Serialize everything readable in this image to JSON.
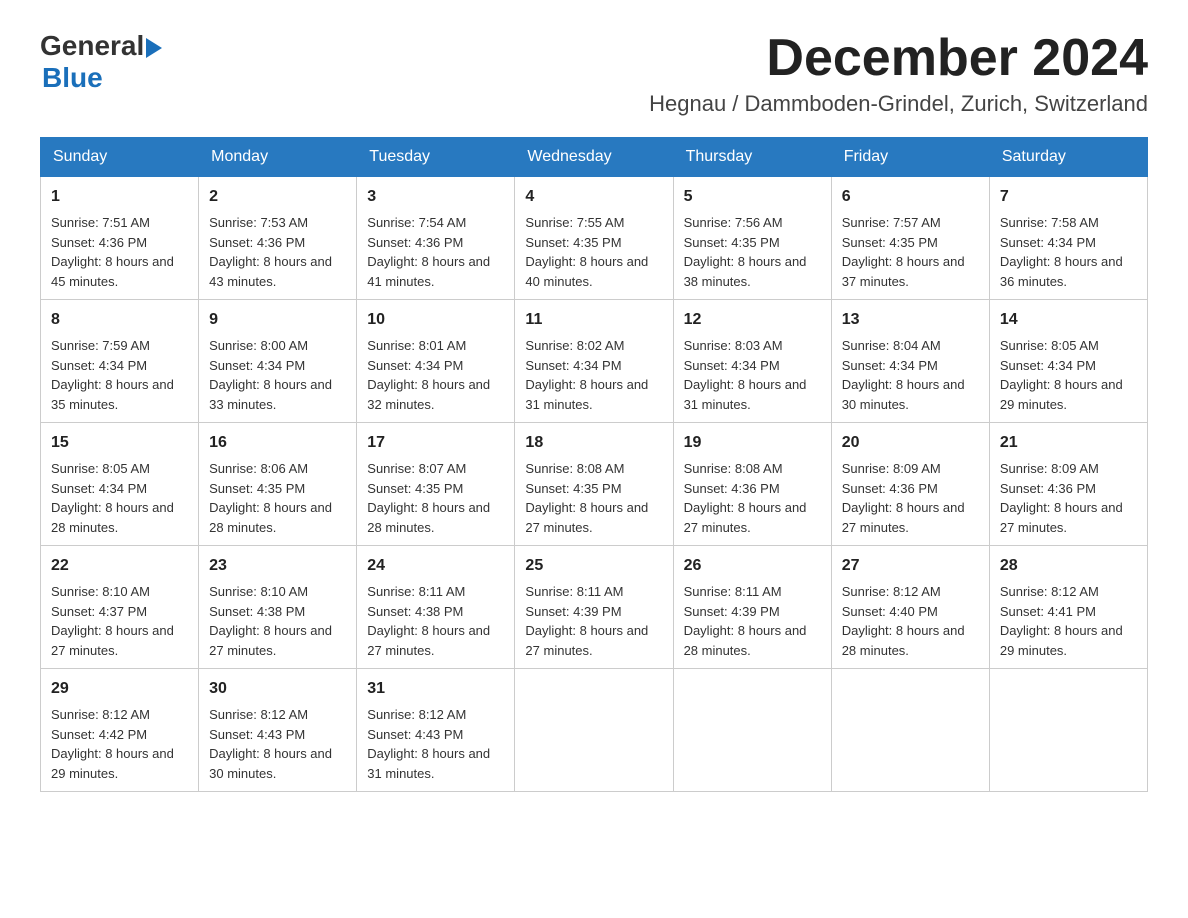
{
  "header": {
    "logo_general": "General",
    "logo_blue": "Blue",
    "month_title": "December 2024",
    "location": "Hegnau / Dammboden-Grindel, Zurich, Switzerland"
  },
  "days_of_week": [
    "Sunday",
    "Monday",
    "Tuesday",
    "Wednesday",
    "Thursday",
    "Friday",
    "Saturday"
  ],
  "weeks": [
    [
      {
        "day": "1",
        "sunrise": "7:51 AM",
        "sunset": "4:36 PM",
        "daylight": "8 hours and 45 minutes."
      },
      {
        "day": "2",
        "sunrise": "7:53 AM",
        "sunset": "4:36 PM",
        "daylight": "8 hours and 43 minutes."
      },
      {
        "day": "3",
        "sunrise": "7:54 AM",
        "sunset": "4:36 PM",
        "daylight": "8 hours and 41 minutes."
      },
      {
        "day": "4",
        "sunrise": "7:55 AM",
        "sunset": "4:35 PM",
        "daylight": "8 hours and 40 minutes."
      },
      {
        "day": "5",
        "sunrise": "7:56 AM",
        "sunset": "4:35 PM",
        "daylight": "8 hours and 38 minutes."
      },
      {
        "day": "6",
        "sunrise": "7:57 AM",
        "sunset": "4:35 PM",
        "daylight": "8 hours and 37 minutes."
      },
      {
        "day": "7",
        "sunrise": "7:58 AM",
        "sunset": "4:34 PM",
        "daylight": "8 hours and 36 minutes."
      }
    ],
    [
      {
        "day": "8",
        "sunrise": "7:59 AM",
        "sunset": "4:34 PM",
        "daylight": "8 hours and 35 minutes."
      },
      {
        "day": "9",
        "sunrise": "8:00 AM",
        "sunset": "4:34 PM",
        "daylight": "8 hours and 33 minutes."
      },
      {
        "day": "10",
        "sunrise": "8:01 AM",
        "sunset": "4:34 PM",
        "daylight": "8 hours and 32 minutes."
      },
      {
        "day": "11",
        "sunrise": "8:02 AM",
        "sunset": "4:34 PM",
        "daylight": "8 hours and 31 minutes."
      },
      {
        "day": "12",
        "sunrise": "8:03 AM",
        "sunset": "4:34 PM",
        "daylight": "8 hours and 31 minutes."
      },
      {
        "day": "13",
        "sunrise": "8:04 AM",
        "sunset": "4:34 PM",
        "daylight": "8 hours and 30 minutes."
      },
      {
        "day": "14",
        "sunrise": "8:05 AM",
        "sunset": "4:34 PM",
        "daylight": "8 hours and 29 minutes."
      }
    ],
    [
      {
        "day": "15",
        "sunrise": "8:05 AM",
        "sunset": "4:34 PM",
        "daylight": "8 hours and 28 minutes."
      },
      {
        "day": "16",
        "sunrise": "8:06 AM",
        "sunset": "4:35 PM",
        "daylight": "8 hours and 28 minutes."
      },
      {
        "day": "17",
        "sunrise": "8:07 AM",
        "sunset": "4:35 PM",
        "daylight": "8 hours and 28 minutes."
      },
      {
        "day": "18",
        "sunrise": "8:08 AM",
        "sunset": "4:35 PM",
        "daylight": "8 hours and 27 minutes."
      },
      {
        "day": "19",
        "sunrise": "8:08 AM",
        "sunset": "4:36 PM",
        "daylight": "8 hours and 27 minutes."
      },
      {
        "day": "20",
        "sunrise": "8:09 AM",
        "sunset": "4:36 PM",
        "daylight": "8 hours and 27 minutes."
      },
      {
        "day": "21",
        "sunrise": "8:09 AM",
        "sunset": "4:36 PM",
        "daylight": "8 hours and 27 minutes."
      }
    ],
    [
      {
        "day": "22",
        "sunrise": "8:10 AM",
        "sunset": "4:37 PM",
        "daylight": "8 hours and 27 minutes."
      },
      {
        "day": "23",
        "sunrise": "8:10 AM",
        "sunset": "4:38 PM",
        "daylight": "8 hours and 27 minutes."
      },
      {
        "day": "24",
        "sunrise": "8:11 AM",
        "sunset": "4:38 PM",
        "daylight": "8 hours and 27 minutes."
      },
      {
        "day": "25",
        "sunrise": "8:11 AM",
        "sunset": "4:39 PM",
        "daylight": "8 hours and 27 minutes."
      },
      {
        "day": "26",
        "sunrise": "8:11 AM",
        "sunset": "4:39 PM",
        "daylight": "8 hours and 28 minutes."
      },
      {
        "day": "27",
        "sunrise": "8:12 AM",
        "sunset": "4:40 PM",
        "daylight": "8 hours and 28 minutes."
      },
      {
        "day": "28",
        "sunrise": "8:12 AM",
        "sunset": "4:41 PM",
        "daylight": "8 hours and 29 minutes."
      }
    ],
    [
      {
        "day": "29",
        "sunrise": "8:12 AM",
        "sunset": "4:42 PM",
        "daylight": "8 hours and 29 minutes."
      },
      {
        "day": "30",
        "sunrise": "8:12 AM",
        "sunset": "4:43 PM",
        "daylight": "8 hours and 30 minutes."
      },
      {
        "day": "31",
        "sunrise": "8:12 AM",
        "sunset": "4:43 PM",
        "daylight": "8 hours and 31 minutes."
      },
      null,
      null,
      null,
      null
    ]
  ]
}
